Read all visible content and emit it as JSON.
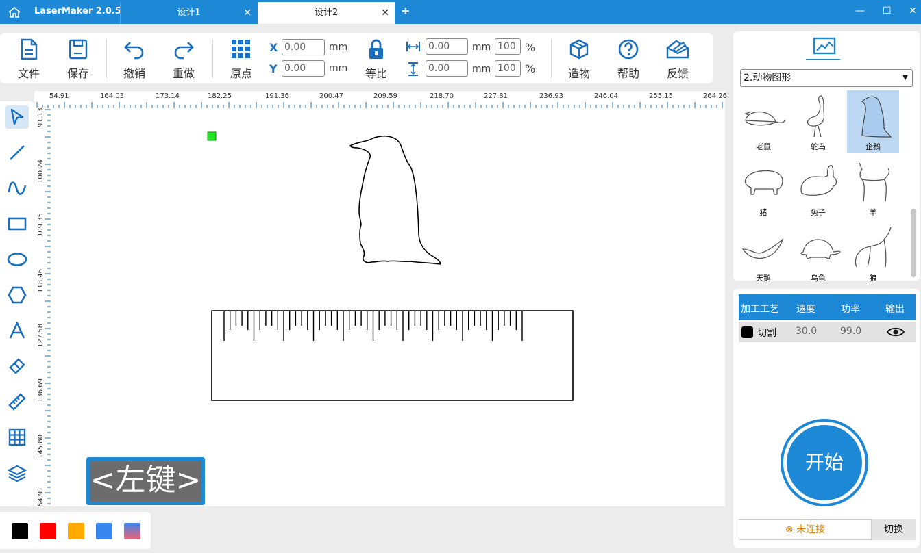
{
  "app": {
    "title": "LaserMaker 2.0.5"
  },
  "tabs": [
    {
      "label": "设计1"
    },
    {
      "label": "设计2"
    }
  ],
  "toolbar": {
    "file": "文件",
    "save": "保存",
    "undo": "撤销",
    "redo": "重做",
    "origin": "原点",
    "x_label": "X",
    "y_label": "Y",
    "x_value": "0.00",
    "y_value": "0.00",
    "unit_mm": "mm",
    "lock": "等比",
    "w_value": "0.00",
    "h_value": "0.00",
    "w_pct": "100",
    "h_pct": "100",
    "pct": "%",
    "build": "造物",
    "help": "帮助",
    "feedback": "反馈"
  },
  "ruler": {
    "h": [
      "54.91",
      "164.03",
      "173.14",
      "182.25",
      "191.36",
      "200.47",
      "209.59",
      "218.70",
      "227.81",
      "236.93",
      "246.04",
      "255.15",
      "264.26"
    ],
    "v": [
      "91.13",
      "100.24",
      "109.35",
      "118.46",
      "127.58",
      "136.69",
      "145.80",
      "54.91"
    ]
  },
  "overlay": {
    "left_key": "<左键>"
  },
  "palette": {
    "colors": [
      "#000000",
      "#ff0000",
      "#ffaa00",
      "#3a86f0",
      "gradient"
    ]
  },
  "shapes": {
    "category": "2.动物图形",
    "items": [
      {
        "name": "老鼠"
      },
      {
        "name": "鸵鸟"
      },
      {
        "name": "企鹅",
        "selected": true
      },
      {
        "name": "猪"
      },
      {
        "name": "兔子"
      },
      {
        "name": "羊"
      },
      {
        "name": "天鹅"
      },
      {
        "name": "乌龟"
      },
      {
        "name": "狼"
      }
    ]
  },
  "layers": {
    "headers": [
      "加工工艺",
      "速度",
      "功率",
      "输出"
    ],
    "rows": [
      {
        "process": "切割",
        "speed": "30.0",
        "power": "99.0",
        "color": "#000000"
      }
    ]
  },
  "start_label": "开始",
  "connection": {
    "status": "未连接",
    "switch": "切换"
  },
  "colors": {
    "accent": "#1d88d6"
  }
}
